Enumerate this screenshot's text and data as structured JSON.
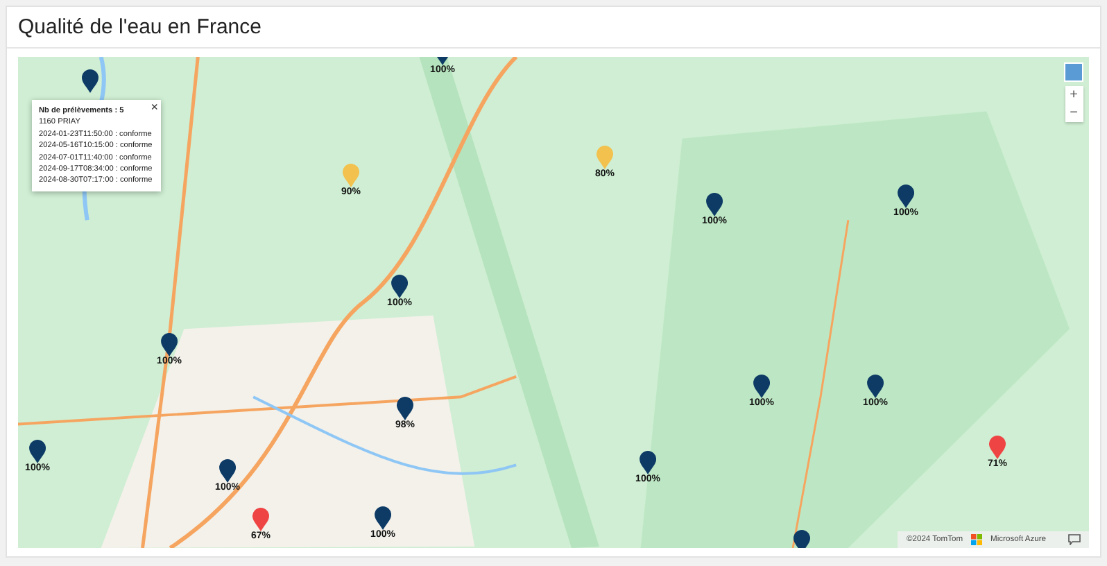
{
  "title": "Qualité de l'eau en France",
  "markers": [
    {
      "color": "#0d3b66"
    },
    {
      "color": "#0d3b66",
      "label": "100%"
    },
    {
      "color": "#f2c14e",
      "label": "90%"
    },
    {
      "color": "#f2c14e",
      "label": "80%"
    },
    {
      "color": "#0d3b66",
      "label": "100%"
    },
    {
      "color": "#0d3b66",
      "label": "100%"
    },
    {
      "color": "#0d3b66",
      "label": "100%"
    },
    {
      "color": "#0d3b66",
      "label": "100%"
    },
    {
      "color": "#0d3b66",
      "label": "98%"
    },
    {
      "color": "#0d3b66",
      "label": "100%"
    },
    {
      "color": "#0d3b66",
      "label": "100%"
    },
    {
      "color": "#0d3b66",
      "label": "100%"
    },
    {
      "color": "#0d3b66",
      "label": "100%"
    },
    {
      "color": "#0d3b66",
      "label": "100%"
    },
    {
      "color": "#ef4444",
      "label": "71%"
    },
    {
      "color": "#ef4444",
      "label": "67%"
    },
    {
      "color": "#0d3b66",
      "label": "100%"
    },
    {
      "color": "#0d3b66"
    }
  ],
  "popup": {
    "close": "×",
    "heading": "Nb de prélèvements : 5",
    "place": "1160 PRIAY",
    "lines": [
      "2024-01-23T11:50:00 : conforme",
      "2024-05-16T10:15:00 : conforme",
      "2024-07-01T11:40:00 : conforme",
      "2024-09-17T08:34:00 : conforme",
      "2024-08-30T07:17:00 : conforme"
    ]
  },
  "zoom_controls": [
    "+",
    "−"
  ],
  "attribution": {
    "copyright": "©2024 TomTom",
    "provider": "Microsoft Azure"
  }
}
